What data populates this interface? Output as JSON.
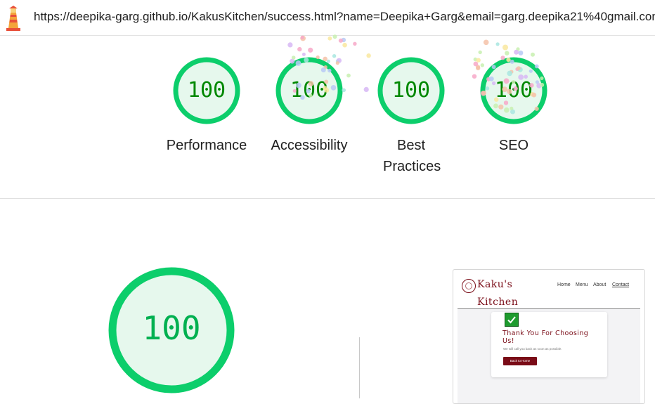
{
  "url_bar": {
    "url": "https://deepika-garg.github.io/KakusKitchen/success.html?name=Deepika+Garg&email=garg.deepika21%40gmail.com",
    "logo_icon": "lighthouse-icon"
  },
  "scores": [
    {
      "label": "Performance",
      "value": "100"
    },
    {
      "label": "Accessibility",
      "value": "100"
    },
    {
      "label": "Best Practices",
      "value": "100"
    },
    {
      "label": "SEO",
      "value": "100"
    }
  ],
  "overall_score": "100",
  "colors": {
    "pass": "#0cce6b",
    "pass_bg": "#e6f8ed",
    "pass_text": "#008800",
    "brand": "#7a0c17"
  },
  "screenshot": {
    "brand": "Kaku's Kitchen",
    "nav": [
      "Home",
      "Menu",
      "About",
      "Contact"
    ],
    "check_icon": "checkmark-icon",
    "title": "Thank You For Choosing Us!",
    "subtitle": "We will call you back as soon as possible.",
    "button": "Back to Home"
  }
}
